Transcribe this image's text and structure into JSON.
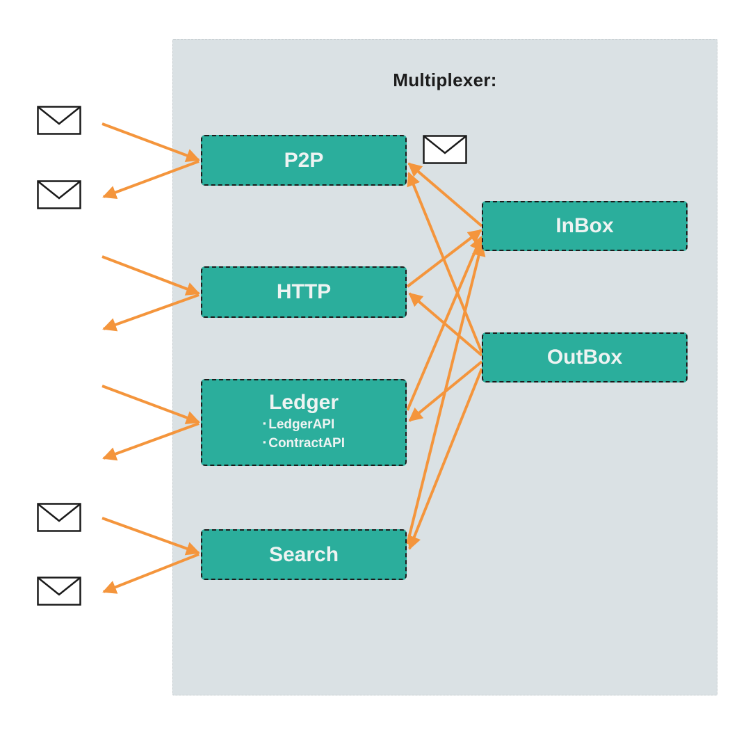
{
  "diagram": {
    "title": "Multiplexer:",
    "nodes": {
      "p2p": {
        "label": "P2P"
      },
      "http": {
        "label": "HTTP"
      },
      "ledger": {
        "label": "Ledger",
        "items": [
          "LedgerAPI",
          "ContractAPI"
        ]
      },
      "search": {
        "label": "Search"
      },
      "inbox": {
        "label": "InBox"
      },
      "outbox": {
        "label": "OutBox"
      }
    },
    "envelopes": [
      "p2p-incoming-message",
      "p2p-outgoing-message",
      "p2p-internal-message",
      "search-incoming-message",
      "search-outgoing-message"
    ],
    "edges": [
      {
        "from": "external",
        "to": "p2p",
        "direction": "in"
      },
      {
        "from": "p2p",
        "to": "external",
        "direction": "out"
      },
      {
        "from": "external",
        "to": "http",
        "direction": "in"
      },
      {
        "from": "http",
        "to": "external",
        "direction": "out"
      },
      {
        "from": "external",
        "to": "ledger",
        "direction": "in"
      },
      {
        "from": "ledger",
        "to": "external",
        "direction": "out"
      },
      {
        "from": "external",
        "to": "search",
        "direction": "in"
      },
      {
        "from": "search",
        "to": "external",
        "direction": "out"
      },
      {
        "from": "inbox",
        "to": "p2p"
      },
      {
        "from": "outbox",
        "to": "p2p"
      },
      {
        "from": "http",
        "to": "inbox"
      },
      {
        "from": "outbox",
        "to": "http"
      },
      {
        "from": "ledger",
        "to": "inbox"
      },
      {
        "from": "outbox",
        "to": "ledger"
      },
      {
        "from": "search",
        "to": "inbox"
      },
      {
        "from": "outbox",
        "to": "search"
      }
    ],
    "colors": {
      "container": "#dae1e4",
      "node": "#2bae9c",
      "node_text": "#eef3f2",
      "arrow": "#f4953c",
      "title": "#1c1c1c"
    }
  }
}
